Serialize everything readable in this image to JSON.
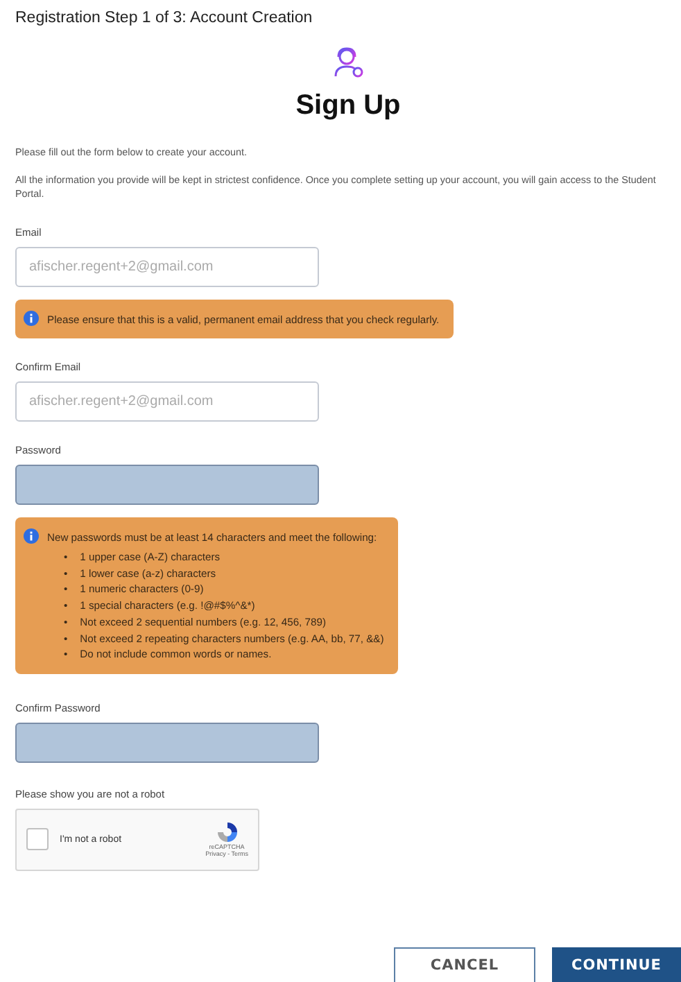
{
  "page_title": "Registration Step 1 of 3: Account Creation",
  "heading": "Sign Up",
  "intro": [
    "Please fill out the form below to create your account.",
    "All the information you provide will be kept in strictest confidence. Once you complete setting up your account, you will gain access to the Student Portal."
  ],
  "fields": [
    {
      "label": "Email",
      "kind": "text",
      "placeholder": "afischer.regent+2@gmail.com",
      "notice": {
        "text": "Please ensure that this is a valid, permanent email address that you check regularly."
      }
    },
    {
      "label": "Confirm Email",
      "kind": "text",
      "placeholder": "afischer.regent+2@gmail.com"
    },
    {
      "label": "Password",
      "kind": "password",
      "notice": {
        "text": "New passwords must be at least 14 characters and meet the following:",
        "marker": "•",
        "items": [
          "1 upper case (A-Z) characters",
          "1 lower case (a-z) characters",
          "1 numeric characters (0-9)",
          "1 special characters (e.g. !@#$%^&*)",
          "Not exceed 2 sequential numbers (e.g. 12, 456, 789)",
          "Not exceed 2 repeating characters numbers (e.g. AA, bb, 77, &&)",
          "Do not include common words or names."
        ]
      }
    },
    {
      "label": "Confirm Password",
      "kind": "password"
    }
  ],
  "captcha": {
    "label": "Please show you are not a robot",
    "text": "I'm not a robot",
    "checked": false,
    "brand": "reCAPTCHA",
    "links": "Privacy - Terms"
  },
  "buttons": [
    {
      "label": "CANCEL",
      "kind": "secondary"
    },
    {
      "label": "CONTINUE",
      "kind": "primary"
    }
  ]
}
